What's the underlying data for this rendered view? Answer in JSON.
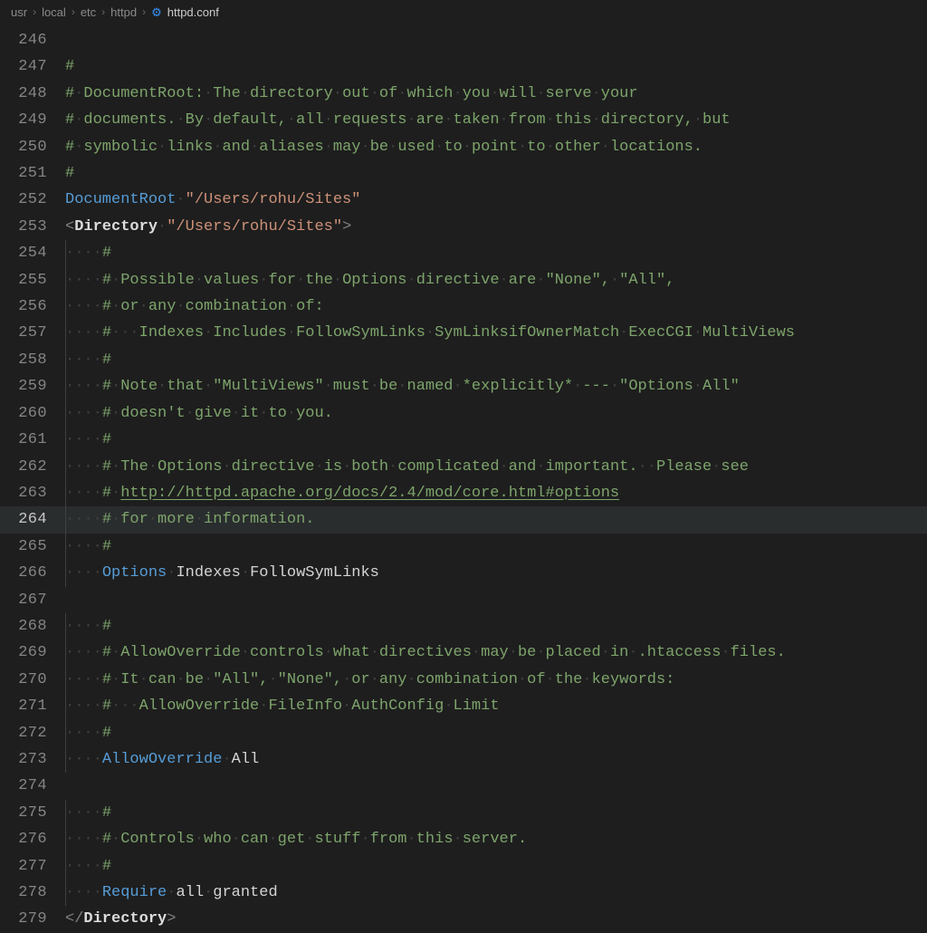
{
  "breadcrumb": {
    "items": [
      "usr",
      "local",
      "etc",
      "httpd"
    ],
    "current": "httpd.conf",
    "separator": "›"
  },
  "colors": {
    "bg": "#1e1e1e",
    "comment": "#7da46b",
    "directive": "#569cd6",
    "string": "#ce9178",
    "text": "#d4d4d4"
  },
  "editor": {
    "first_line": 246,
    "current_line": 264,
    "indent_dots": "····",
    "lines": [
      {
        "n": 246,
        "indent": 0,
        "tokens": []
      },
      {
        "n": 247,
        "indent": 0,
        "tokens": [
          {
            "cls": "c-comment",
            "t": "#"
          }
        ]
      },
      {
        "n": 248,
        "indent": 0,
        "tokens": [
          {
            "cls": "c-comment",
            "t": "# DocumentRoot: The directory out of which you will serve your"
          }
        ]
      },
      {
        "n": 249,
        "indent": 0,
        "tokens": [
          {
            "cls": "c-comment",
            "t": "# documents. By default, all requests are taken from this directory, but"
          }
        ]
      },
      {
        "n": 250,
        "indent": 0,
        "tokens": [
          {
            "cls": "c-comment",
            "t": "# symbolic links and aliases may be used to point to other locations."
          }
        ]
      },
      {
        "n": 251,
        "indent": 0,
        "tokens": [
          {
            "cls": "c-comment",
            "t": "#"
          }
        ]
      },
      {
        "n": 252,
        "indent": 0,
        "tokens": [
          {
            "cls": "c-directive",
            "t": "DocumentRoot"
          },
          {
            "cls": "c-default",
            "t": " "
          },
          {
            "cls": "c-string",
            "t": "\"/Users/rohu/Sites\""
          }
        ]
      },
      {
        "n": 253,
        "indent": 0,
        "tokens": [
          {
            "cls": "c-angle",
            "t": "<"
          },
          {
            "cls": "c-tagname",
            "t": "Directory"
          },
          {
            "cls": "c-default",
            "t": " "
          },
          {
            "cls": "c-string",
            "t": "\"/Users/rohu/Sites\""
          },
          {
            "cls": "c-angle",
            "t": ">"
          }
        ]
      },
      {
        "n": 254,
        "indent": 1,
        "guide": true,
        "tokens": [
          {
            "cls": "c-comment",
            "t": "#"
          }
        ]
      },
      {
        "n": 255,
        "indent": 1,
        "guide": true,
        "tokens": [
          {
            "cls": "c-comment",
            "t": "# Possible values for the Options directive are \"None\", \"All\","
          }
        ]
      },
      {
        "n": 256,
        "indent": 1,
        "guide": true,
        "tokens": [
          {
            "cls": "c-comment",
            "t": "# or any combination of:"
          }
        ]
      },
      {
        "n": 257,
        "indent": 1,
        "guide": true,
        "tokens": [
          {
            "cls": "c-comment",
            "t": "#   Indexes Includes FollowSymLinks SymLinksifOwnerMatch ExecCGI MultiViews"
          }
        ]
      },
      {
        "n": 258,
        "indent": 1,
        "guide": true,
        "tokens": [
          {
            "cls": "c-comment",
            "t": "#"
          }
        ]
      },
      {
        "n": 259,
        "indent": 1,
        "guide": true,
        "tokens": [
          {
            "cls": "c-comment",
            "t": "# Note that \"MultiViews\" must be named *explicitly* --- \"Options All\""
          }
        ]
      },
      {
        "n": 260,
        "indent": 1,
        "guide": true,
        "tokens": [
          {
            "cls": "c-comment",
            "t": "# doesn't give it to you."
          }
        ]
      },
      {
        "n": 261,
        "indent": 1,
        "guide": true,
        "tokens": [
          {
            "cls": "c-comment",
            "t": "#"
          }
        ]
      },
      {
        "n": 262,
        "indent": 1,
        "guide": true,
        "tokens": [
          {
            "cls": "c-comment",
            "t": "# The Options directive is both complicated and important.  Please see"
          }
        ]
      },
      {
        "n": 263,
        "indent": 1,
        "guide": true,
        "tokens": [
          {
            "cls": "c-comment",
            "t": "# "
          },
          {
            "cls": "c-link",
            "t": "http://httpd.apache.org/docs/2.4/mod/core.html#options"
          }
        ]
      },
      {
        "n": 264,
        "indent": 1,
        "guide": true,
        "tokens": [
          {
            "cls": "c-comment",
            "t": "# for more information."
          }
        ]
      },
      {
        "n": 265,
        "indent": 1,
        "guide": true,
        "tokens": [
          {
            "cls": "c-comment",
            "t": "#"
          }
        ]
      },
      {
        "n": 266,
        "indent": 1,
        "guide": true,
        "tokens": [
          {
            "cls": "c-directive",
            "t": "Options"
          },
          {
            "cls": "c-default",
            "t": " Indexes FollowSymLinks"
          }
        ]
      },
      {
        "n": 267,
        "indent": 0,
        "guide": true,
        "tokens": []
      },
      {
        "n": 268,
        "indent": 1,
        "guide": true,
        "tokens": [
          {
            "cls": "c-comment",
            "t": "#"
          }
        ]
      },
      {
        "n": 269,
        "indent": 1,
        "guide": true,
        "tokens": [
          {
            "cls": "c-comment",
            "t": "# AllowOverride controls what directives may be placed in .htaccess files."
          }
        ]
      },
      {
        "n": 270,
        "indent": 1,
        "guide": true,
        "tokens": [
          {
            "cls": "c-comment",
            "t": "# It can be \"All\", \"None\", or any combination of the keywords:"
          }
        ]
      },
      {
        "n": 271,
        "indent": 1,
        "guide": true,
        "tokens": [
          {
            "cls": "c-comment",
            "t": "#   AllowOverride FileInfo AuthConfig Limit"
          }
        ]
      },
      {
        "n": 272,
        "indent": 1,
        "guide": true,
        "tokens": [
          {
            "cls": "c-comment",
            "t": "#"
          }
        ]
      },
      {
        "n": 273,
        "indent": 1,
        "guide": true,
        "tokens": [
          {
            "cls": "c-directive",
            "t": "AllowOverride"
          },
          {
            "cls": "c-default",
            "t": " All"
          }
        ]
      },
      {
        "n": 274,
        "indent": 0,
        "guide": true,
        "tokens": []
      },
      {
        "n": 275,
        "indent": 1,
        "guide": true,
        "tokens": [
          {
            "cls": "c-comment",
            "t": "#"
          }
        ]
      },
      {
        "n": 276,
        "indent": 1,
        "guide": true,
        "tokens": [
          {
            "cls": "c-comment",
            "t": "# Controls who can get stuff from this server."
          }
        ]
      },
      {
        "n": 277,
        "indent": 1,
        "guide": true,
        "tokens": [
          {
            "cls": "c-comment",
            "t": "#"
          }
        ]
      },
      {
        "n": 278,
        "indent": 1,
        "guide": true,
        "tokens": [
          {
            "cls": "c-directive",
            "t": "Require"
          },
          {
            "cls": "c-default",
            "t": " all granted"
          }
        ]
      },
      {
        "n": 279,
        "indent": 0,
        "tokens": [
          {
            "cls": "c-angle",
            "t": "</"
          },
          {
            "cls": "c-tagname",
            "t": "Directory"
          },
          {
            "cls": "c-angle",
            "t": ">"
          }
        ]
      }
    ]
  }
}
